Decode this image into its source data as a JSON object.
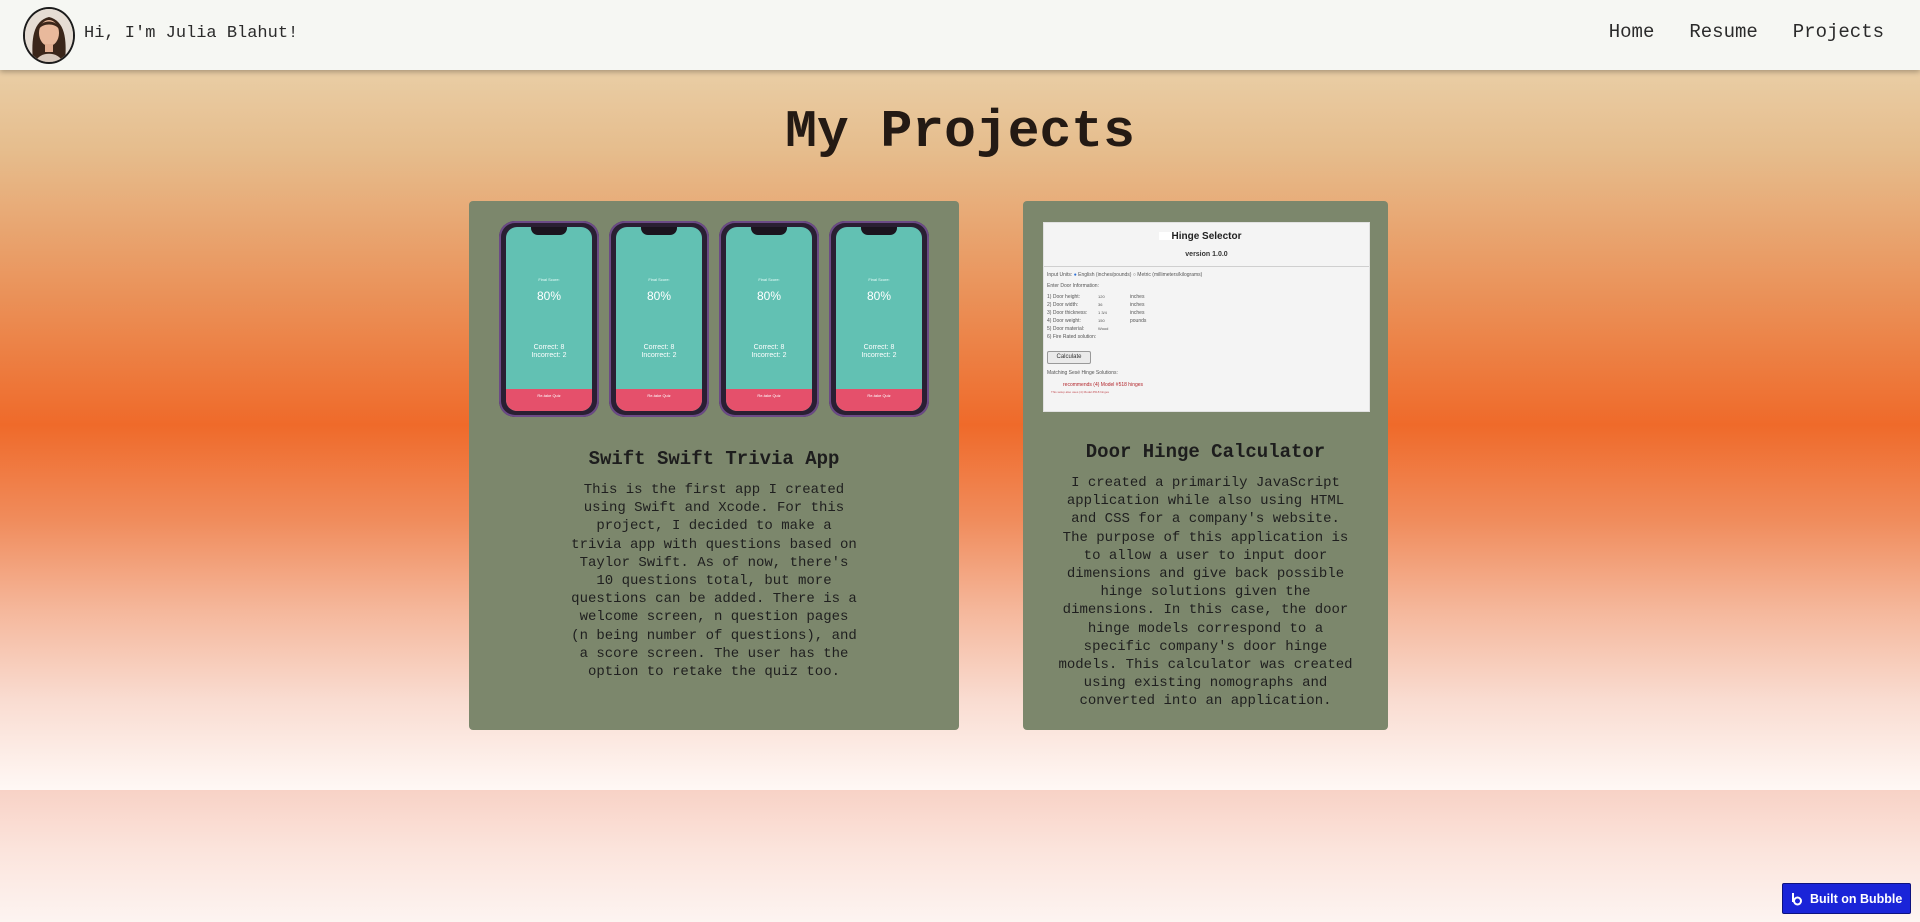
{
  "header": {
    "greeting": "Hi, I'm Julia Blahut!",
    "nav": {
      "home": "Home",
      "resume": "Resume",
      "projects": "Projects"
    }
  },
  "main": {
    "title": "My Projects",
    "projects": [
      {
        "title": "Swift Swift Trivia App",
        "description": "This is the first app I created using Swift and Xcode. For this project, I decided to make a trivia app with questions based on Taylor Swift. As of now, there's 10 questions total, but more questions can be added. There is a welcome screen, n question pages (n being number of questions), and a score screen. The user has the option to retake the quiz too.",
        "preview": {
          "heading": "Final Score:",
          "score": "80%",
          "correct": "Correct: 8",
          "incorrect": "Incorrect: 2",
          "button": "Re-take Quiz"
        }
      },
      {
        "title": "Door Hinge Calculator",
        "description": "I created a primarily JavaScript application while also using HTML and CSS for a company's website. The purpose of this application is to allow a user to input door dimensions and give back possible hinge solutions given the dimensions. In this case, the door hinge models correspond to a specific company's door hinge models. This calculator was created using existing nomographs and converted into an application.",
        "preview": {
          "title": "Hinge Selector",
          "version": "version 1.0.0",
          "input_units": "Input Units:",
          "english": "English (inches/pounds)",
          "metric": "Metric (millimeters/kilograms)",
          "enter_info": "Enter Door Information:",
          "fields": [
            "1) Door height:",
            "2) Door width:",
            "3) Door thickness:",
            "4) Door weight:",
            "5) Door material:",
            "6) Fire Rated solution:"
          ],
          "values": [
            "120",
            "36",
            "1 3/4",
            "150",
            "Wood"
          ],
          "units": [
            "inches",
            "inches",
            "inches",
            "pounds"
          ],
          "calculate": "Calculate",
          "matching": "Matching Sesé Hinge Solutions:",
          "recommends": "recommends (4) Model #518 hinges",
          "note": "This setup also uses (4) Model #518 hinges"
        }
      }
    ]
  },
  "badge": {
    "label": "Built on Bubble"
  },
  "colors": {
    "card": "#7c876c",
    "header": "#f6f7f3",
    "badge": "#1a24d8"
  }
}
